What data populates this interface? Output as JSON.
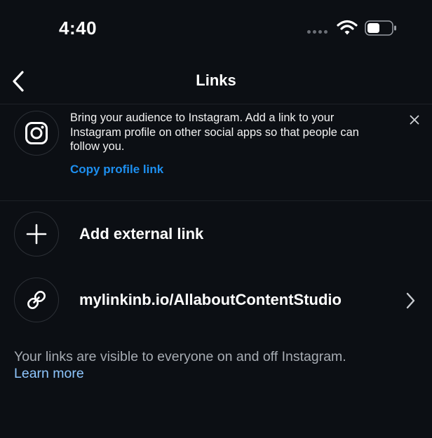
{
  "status_bar": {
    "time": "4:40"
  },
  "header": {
    "title": "Links"
  },
  "promo": {
    "text": "Bring your audience to Instagram. Add a link to your Instagram profile on other social apps so that people can follow you.",
    "link_label": "Copy profile link"
  },
  "links": {
    "add_label": "Add external link",
    "items": [
      {
        "label": "mylinkinb.io/AllaboutContentStudio"
      }
    ]
  },
  "footer": {
    "text": "Your links are visible to everyone on and off Instagram.",
    "learn_more": "Learn more"
  },
  "colors": {
    "background": "#0c0f14",
    "accent_link": "#1d8ff0",
    "footer_link": "#8fc7ff"
  }
}
